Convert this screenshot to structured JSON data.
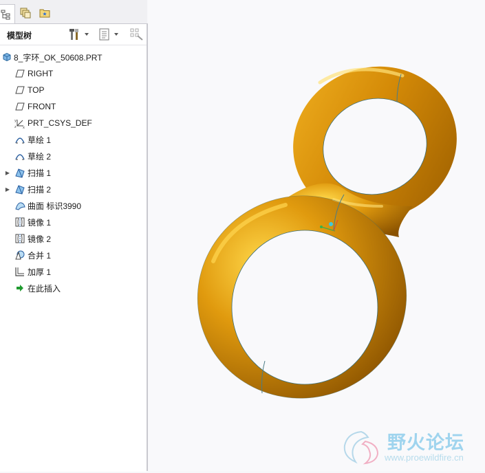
{
  "tabs": [
    {
      "name": "model-tree-tab-icon",
      "active": true
    },
    {
      "name": "layers-tab-icon",
      "active": false
    },
    {
      "name": "favorites-tab-icon",
      "active": false
    }
  ],
  "panel": {
    "title": "模型树",
    "settings_icon": "tools-settings-icon",
    "show_icon": "show-list-icon",
    "filter_icon": "tree-filter-icon"
  },
  "tree": {
    "root": "8_字环_OK_50608.PRT",
    "items": [
      {
        "label": "RIGHT",
        "icon": "datum-plane-icon",
        "expandable": false
      },
      {
        "label": "TOP",
        "icon": "datum-plane-icon",
        "expandable": false
      },
      {
        "label": "FRONT",
        "icon": "datum-plane-icon",
        "expandable": false
      },
      {
        "label": "PRT_CSYS_DEF",
        "icon": "coordinate-system-icon",
        "expandable": false
      },
      {
        "label": "草绘 1",
        "icon": "sketch-icon",
        "expandable": false
      },
      {
        "label": "草绘 2",
        "icon": "sketch-icon",
        "expandable": false
      },
      {
        "label": "扫描 1",
        "icon": "sweep-icon",
        "expandable": true
      },
      {
        "label": "扫描 2",
        "icon": "sweep-icon",
        "expandable": true
      },
      {
        "label": "曲面 标识3990",
        "icon": "surface-icon",
        "expandable": false
      },
      {
        "label": "镜像 1",
        "icon": "mirror-icon",
        "expandable": false
      },
      {
        "label": "镜像 2",
        "icon": "mirror-icon",
        "expandable": false
      },
      {
        "label": "合并 1",
        "icon": "merge-icon",
        "expandable": false
      },
      {
        "label": "加厚 1",
        "icon": "thicken-icon",
        "expandable": false
      },
      {
        "label": "在此插入",
        "icon": "insert-here-arrow-icon",
        "expandable": false
      }
    ]
  },
  "model": {
    "color": "#d48a07",
    "highlight": "#ffd23a",
    "shadow": "#7a4a00"
  },
  "watermark": {
    "title": "野火论坛",
    "url": "www.proewildfire.cn"
  }
}
